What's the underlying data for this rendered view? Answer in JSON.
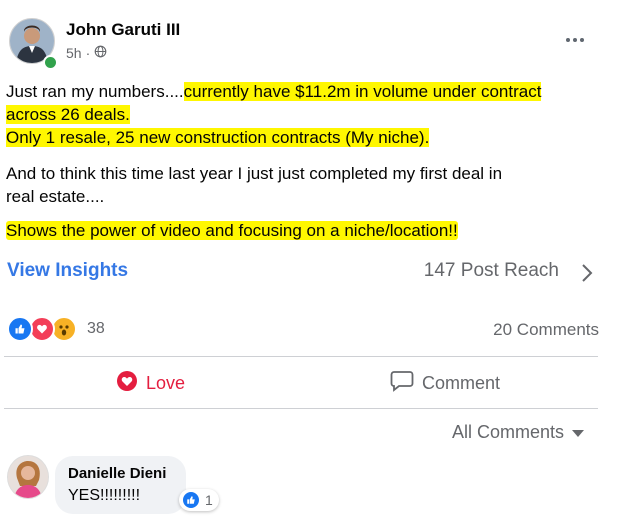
{
  "post": {
    "author": "John Garuti III",
    "time": "5h",
    "time_separator": "·",
    "privacy_icon": "globe-icon",
    "more_icon": "more-options-icon",
    "line1_plain": "Just ran my numbers....",
    "line1_highlight": "currently have $11.2m in volume under contract",
    "line2_highlight": "across 26 deals.",
    "line3_highlight": "Only 1 resale, 25 new construction contracts (My niche).",
    "line4": "And to think this time last year I just just completed my first deal in",
    "line5": "real estate....",
    "line6_highlight": "Shows the power of video and focusing on a niche/location!!"
  },
  "insights": {
    "label": "View Insights",
    "reach": "147 Post Reach"
  },
  "stats": {
    "reaction_icons": [
      "like-reaction-icon",
      "love-reaction-icon",
      "wow-reaction-icon"
    ],
    "reactions_count": "38",
    "comments_count": "20 Comments"
  },
  "actions": {
    "love_label": "Love",
    "comment_label": "Comment"
  },
  "comments": {
    "filter_label": "All Comments",
    "items": [
      {
        "name": "Danielle Dieni",
        "text": "YES!!!!!!!!!",
        "like_count": "1"
      }
    ]
  },
  "colors": {
    "highlight": "#fff700",
    "link_blue": "#3578e5",
    "love_red": "#e41e3f",
    "muted": "#65676b"
  }
}
